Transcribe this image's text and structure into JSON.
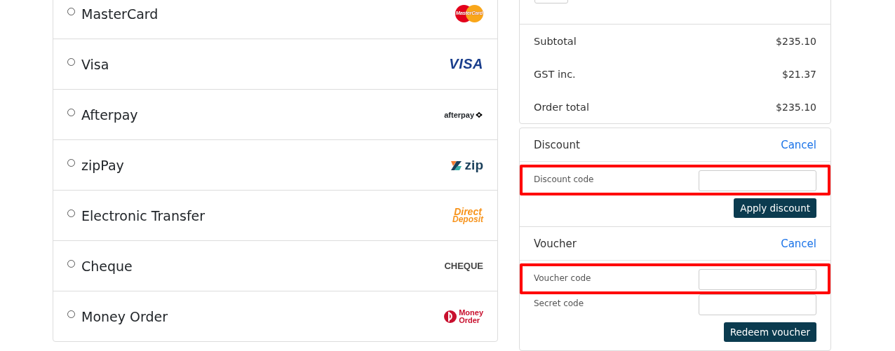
{
  "payment_methods": [
    {
      "label": "MasterCard",
      "selected": false,
      "logo": {
        "kind": "mastercard",
        "text": "MasterCard"
      }
    },
    {
      "label": "Visa",
      "selected": false,
      "logo": {
        "kind": "visa",
        "text": "VISA"
      }
    },
    {
      "label": "Afterpay",
      "selected": false,
      "logo": {
        "kind": "afterpay",
        "text": "afterpay"
      }
    },
    {
      "label": "zipPay",
      "selected": false,
      "logo": {
        "kind": "zip",
        "text": "zip"
      }
    },
    {
      "label": "Electronic Transfer",
      "selected": false,
      "logo": {
        "kind": "direct",
        "text": "Direct",
        "text2": "Deposit"
      }
    },
    {
      "label": "Cheque",
      "selected": false,
      "logo": {
        "kind": "cheque",
        "text": "CHEQUE"
      }
    },
    {
      "label": "Money Order",
      "selected": false,
      "logo": {
        "kind": "money",
        "text": "Money",
        "text2": "Order"
      }
    }
  ],
  "totals": [
    {
      "label": "Subtotal",
      "value": "$235.10"
    },
    {
      "label": "GST inc.",
      "value": "$21.37"
    },
    {
      "label": "Order total",
      "value": "$235.10"
    }
  ],
  "discount": {
    "title": "Discount",
    "cancel": "Cancel",
    "fields": [
      {
        "label": "Discount code",
        "highlighted": true
      }
    ],
    "button": "Apply discount"
  },
  "voucher": {
    "title": "Voucher",
    "cancel": "Cancel",
    "fields": [
      {
        "label": "Voucher code",
        "highlighted": true
      },
      {
        "label": "Secret code",
        "highlighted": false
      }
    ],
    "button": "Redeem voucher"
  }
}
